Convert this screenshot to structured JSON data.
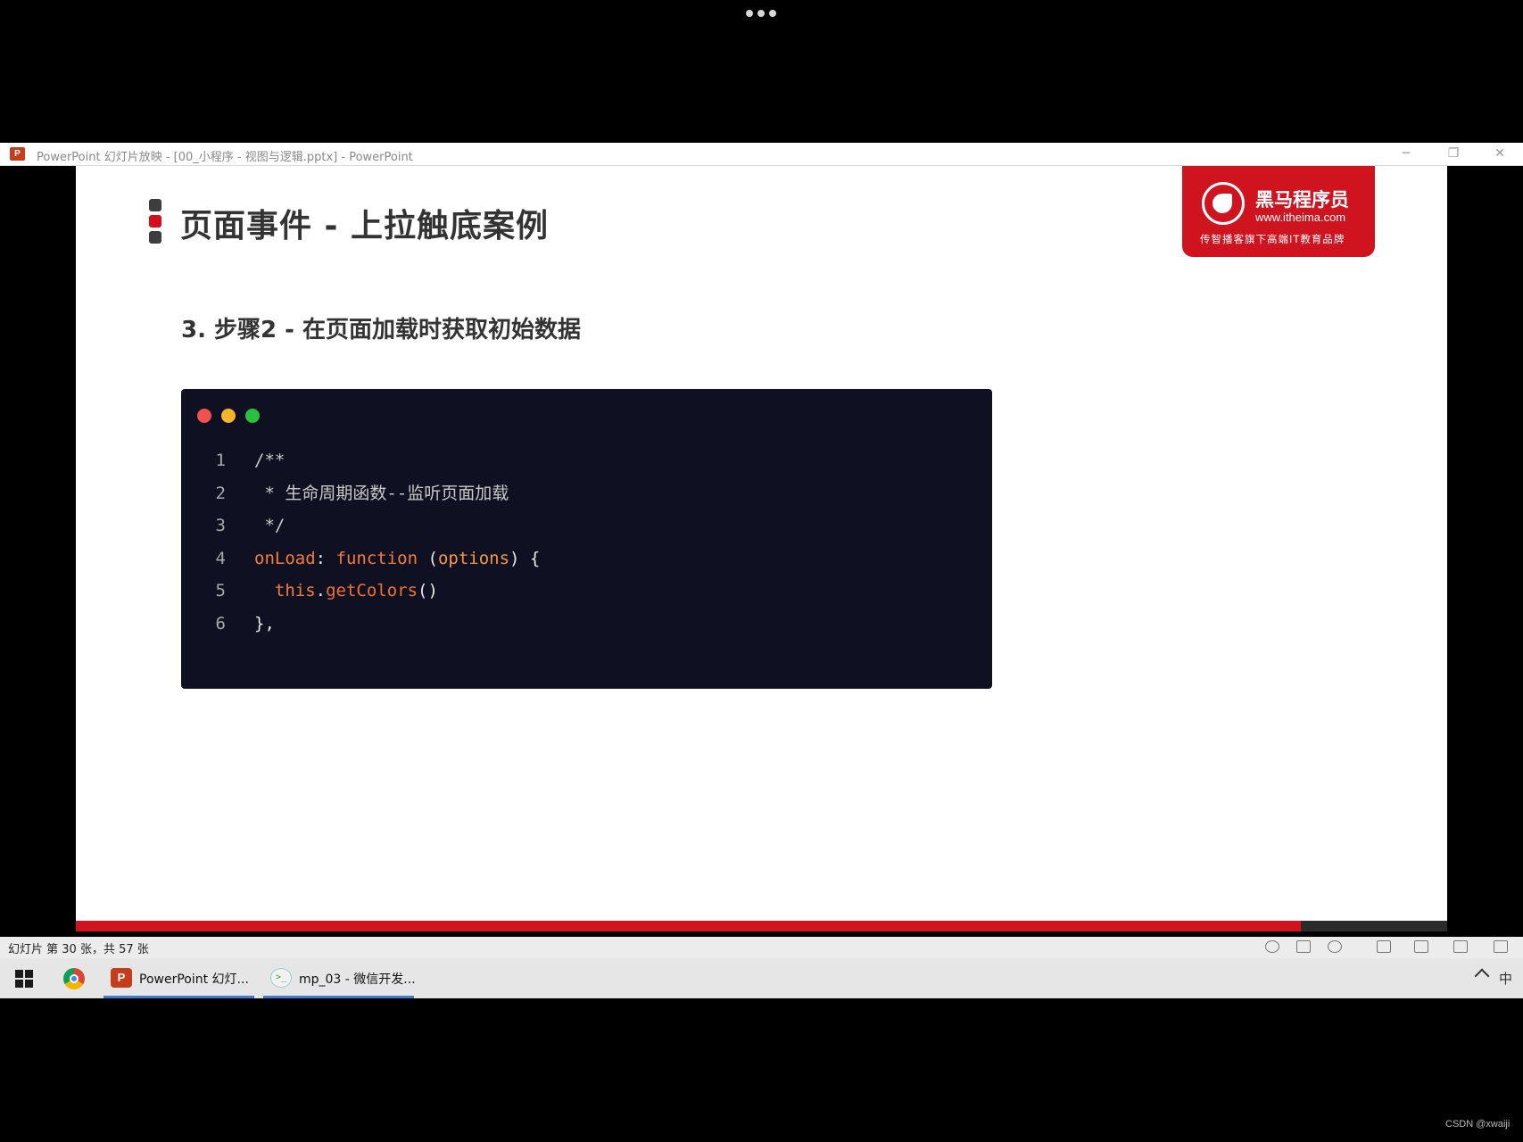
{
  "window": {
    "title": "PowerPoint 幻灯片放映 - [00_小程序 - 视图与逻辑.pptx] - PowerPoint",
    "app_icon": "P",
    "controls": {
      "minimize": "─",
      "restore": "❐",
      "close": "✕"
    }
  },
  "slide": {
    "title": "页面事件 - 上拉触底案例",
    "subtitle": "3. 步骤2 - 在页面加载时获取初始数据",
    "logo": {
      "name": "黑马程序员",
      "url": "www.itheima.com",
      "tagline": "传智播客旗下高端IT教育品牌"
    },
    "code": {
      "lines": [
        {
          "num": "1",
          "parts": [
            {
              "text": "/**",
              "kind": "comment"
            }
          ]
        },
        {
          "num": "2",
          "parts": [
            {
              "text": " * 生命周期函数--监听页面加载",
              "kind": "comment"
            }
          ]
        },
        {
          "num": "3",
          "parts": [
            {
              "text": " */",
              "kind": "comment"
            }
          ]
        },
        {
          "num": "4",
          "parts": [
            {
              "text": "onLoad",
              "kind": "key"
            },
            {
              "text": ": ",
              "kind": "plain"
            },
            {
              "text": "function",
              "kind": "key"
            },
            {
              "text": " (",
              "kind": "plain"
            },
            {
              "text": "options",
              "kind": "param"
            },
            {
              "text": ") {",
              "kind": "plain"
            }
          ]
        },
        {
          "num": "5",
          "parts": [
            {
              "text": "  this",
              "kind": "key"
            },
            {
              "text": ".",
              "kind": "plain"
            },
            {
              "text": "getColors",
              "kind": "fn"
            },
            {
              "text": "()",
              "kind": "plain"
            }
          ]
        },
        {
          "num": "6",
          "parts": [
            {
              "text": "},",
              "kind": "plain"
            }
          ]
        }
      ]
    }
  },
  "statusbar": {
    "slide_counter": "幻灯片 第 30 张，共 57 张"
  },
  "taskbar": {
    "items": [
      {
        "label": "PowerPoint 幻灯...",
        "icon": "P"
      },
      {
        "label": "mp_03 - 微信开发...",
        "icon": ">_"
      }
    ],
    "ime": "中"
  },
  "watermark": "CSDN @xwaiji",
  "colors": {
    "brand_red": "#cf1420",
    "code_bg": "#0f1123",
    "keyword": "#f47c3c"
  }
}
